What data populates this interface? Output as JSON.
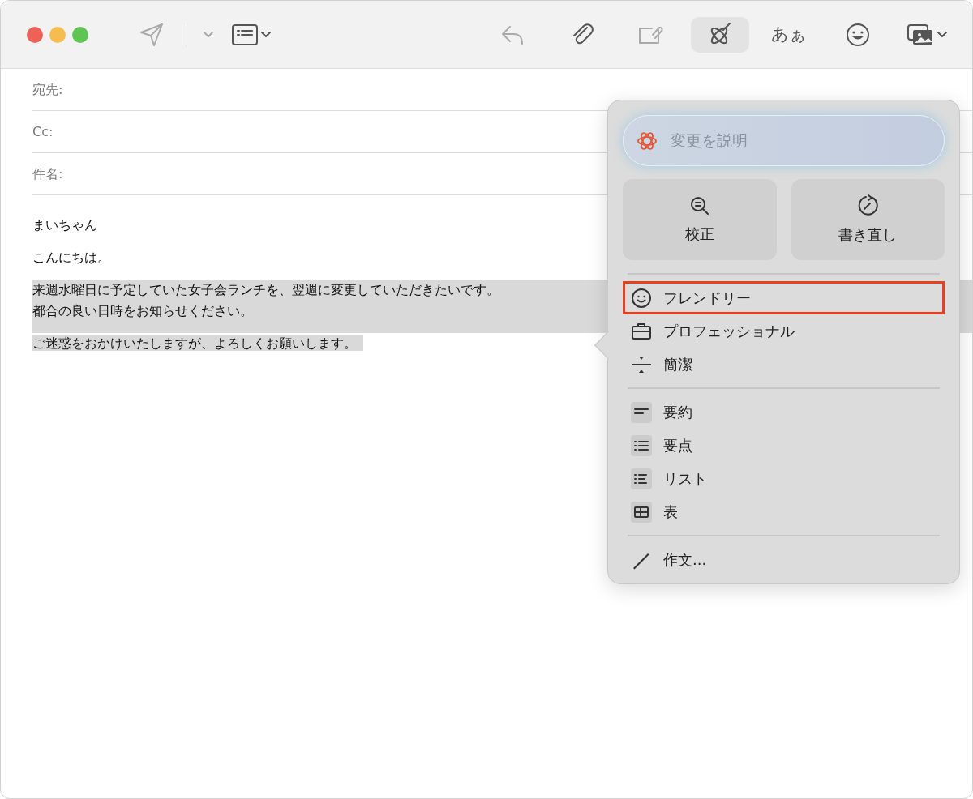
{
  "toolbar": {
    "left": [
      {
        "dropdown": false,
        "disabled": true,
        "selected": false
      },
      {
        "dropdown": true,
        "disabled": true,
        "selected": false
      },
      {
        "dropdown": true,
        "disabled": false,
        "selected": false
      }
    ],
    "right": [
      {
        "disabled": true,
        "selected": false
      },
      {
        "disabled": false,
        "selected": false
      },
      {
        "disabled": true,
        "selected": false
      },
      {
        "disabled": false,
        "selected": true
      },
      {
        "label": "あぁ",
        "disabled": false,
        "selected": false
      },
      {
        "disabled": false,
        "selected": false
      },
      {
        "disabled": false,
        "selected": false,
        "dropdown": true
      }
    ]
  },
  "header_fields": [
    {
      "label": "宛先:"
    },
    {
      "label": "Cc:"
    },
    {
      "label": "件名:"
    }
  ],
  "body": [
    {
      "lines": [
        "まいちゃん"
      ],
      "selected": false
    },
    {
      "lines": [
        "こんにちは。"
      ],
      "selected": false
    },
    {
      "lines": [
        "来週水曜日に予定していた女子会ランチを、翌週に変更していただきたいです。",
        "都合の良い日時をお知らせください。"
      ],
      "selected": true
    },
    {
      "lines": [
        "ご迷惑をおかけいたしますが、よろしくお願いします。"
      ],
      "selected": true
    }
  ],
  "writing_tools": {
    "prompt": {
      "placeholder": "変更を説明"
    },
    "buttons": [
      {
        "label": "校正"
      },
      {
        "label": "書き直し"
      }
    ],
    "sections": [
      [
        {
          "label": "フレンドリー",
          "highlighted": true
        },
        {
          "label": "プロフェッショナル",
          "highlighted": false
        },
        {
          "label": "簡潔",
          "highlighted": false
        }
      ],
      [
        {
          "label": "要約",
          "highlighted": false
        },
        {
          "label": "要点",
          "highlighted": false
        },
        {
          "label": "リスト",
          "highlighted": false
        },
        {
          "label": "表",
          "highlighted": false
        }
      ],
      [
        {
          "label": "作文...",
          "highlighted": false
        }
      ]
    ]
  }
}
